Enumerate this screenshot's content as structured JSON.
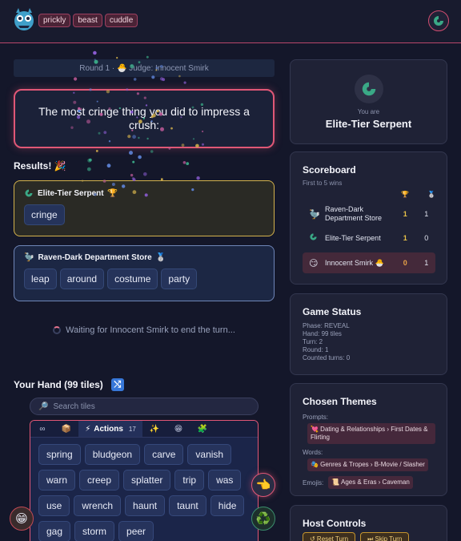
{
  "header": {
    "tags": [
      "prickly",
      "beast",
      "cuddle"
    ],
    "logo_icon": "monster-logo-icon",
    "avatar_icon": "serpent-icon"
  },
  "round": {
    "text": "Round 1 · 🐣 Judge: Innocent Smirk"
  },
  "prompt": {
    "text": "The most cringe thing you did to impress a crush:"
  },
  "results": {
    "title": "Results! 🎉",
    "submissions": [
      {
        "player": "Elite-Tier Serpent",
        "badge": "🏆",
        "cards": [
          "cringe"
        ],
        "winner": true
      },
      {
        "player": "Raven-Dark Department Store",
        "badge": "🥈",
        "cards": [
          "leap",
          "around",
          "costume",
          "party"
        ],
        "winner": false
      }
    ]
  },
  "waiting": {
    "text": "Waiting for Innocent Smirk to end the turn..."
  },
  "hand": {
    "title": "Your Hand (99 tiles)",
    "search_placeholder": "Search tiles",
    "tabs": [
      {
        "icon": "∞",
        "name": "tab-infinity"
      },
      {
        "icon": "📦",
        "name": "tab-box"
      },
      {
        "icon": "⚡",
        "label": "Actions",
        "count": "17",
        "name": "tab-actions"
      },
      {
        "icon": "✨",
        "name": "tab-sparkles"
      },
      {
        "icon": "😁",
        "name": "tab-faces"
      },
      {
        "icon": "🧩",
        "name": "tab-puzzle"
      }
    ],
    "cards": [
      "spring",
      "bludgeon",
      "carve",
      "vanish",
      "warn",
      "creep",
      "splatter",
      "trip",
      "was",
      "use",
      "wrench",
      "haunt",
      "taunt",
      "hide",
      "gag",
      "storm",
      "peer"
    ]
  },
  "player": {
    "you_are_label": "You are",
    "name": "Elite-Tier Serpent"
  },
  "scoreboard": {
    "title": "Scoreboard",
    "subtitle": "First to 5 wins",
    "rows": [
      {
        "icon": "🦤",
        "name": "Raven-Dark Department Store",
        "wins": "1",
        "seconds": "1",
        "highlight": false
      },
      {
        "icon": "🐍",
        "name": "Elite-Tier Serpent",
        "wins": "1",
        "seconds": "0",
        "highlight": false
      },
      {
        "icon": "😏",
        "name": "Innocent Smirk 🐣",
        "wins": "0",
        "seconds": "1",
        "highlight": true
      }
    ]
  },
  "game_status": {
    "title": "Game Status",
    "phase": "Phase: REVEAL",
    "hand": "Hand: 99 tiles",
    "turn": "Turn: 2",
    "round": "Round: 1",
    "counted": "Counted turns: 0"
  },
  "themes": {
    "title": "Chosen Themes",
    "prompts_label": "Prompts:",
    "prompts_value": "💘 Dating & Relationships › First Dates & Flirting",
    "words_label": "Words:",
    "words_value": "🎭 Genres & Tropes › B-Movie / Slasher",
    "emojis_label": "Emojis:",
    "emojis_value": "📜 Ages & Eras › Caveman"
  },
  "host": {
    "title": "Host Controls",
    "reset_label": "↺ Reset Turn",
    "skip_label": "⏭ Skip Turn"
  },
  "colors": {
    "accent": "#e05776",
    "gold": "#d4b24c",
    "teal": "#3aa986"
  }
}
